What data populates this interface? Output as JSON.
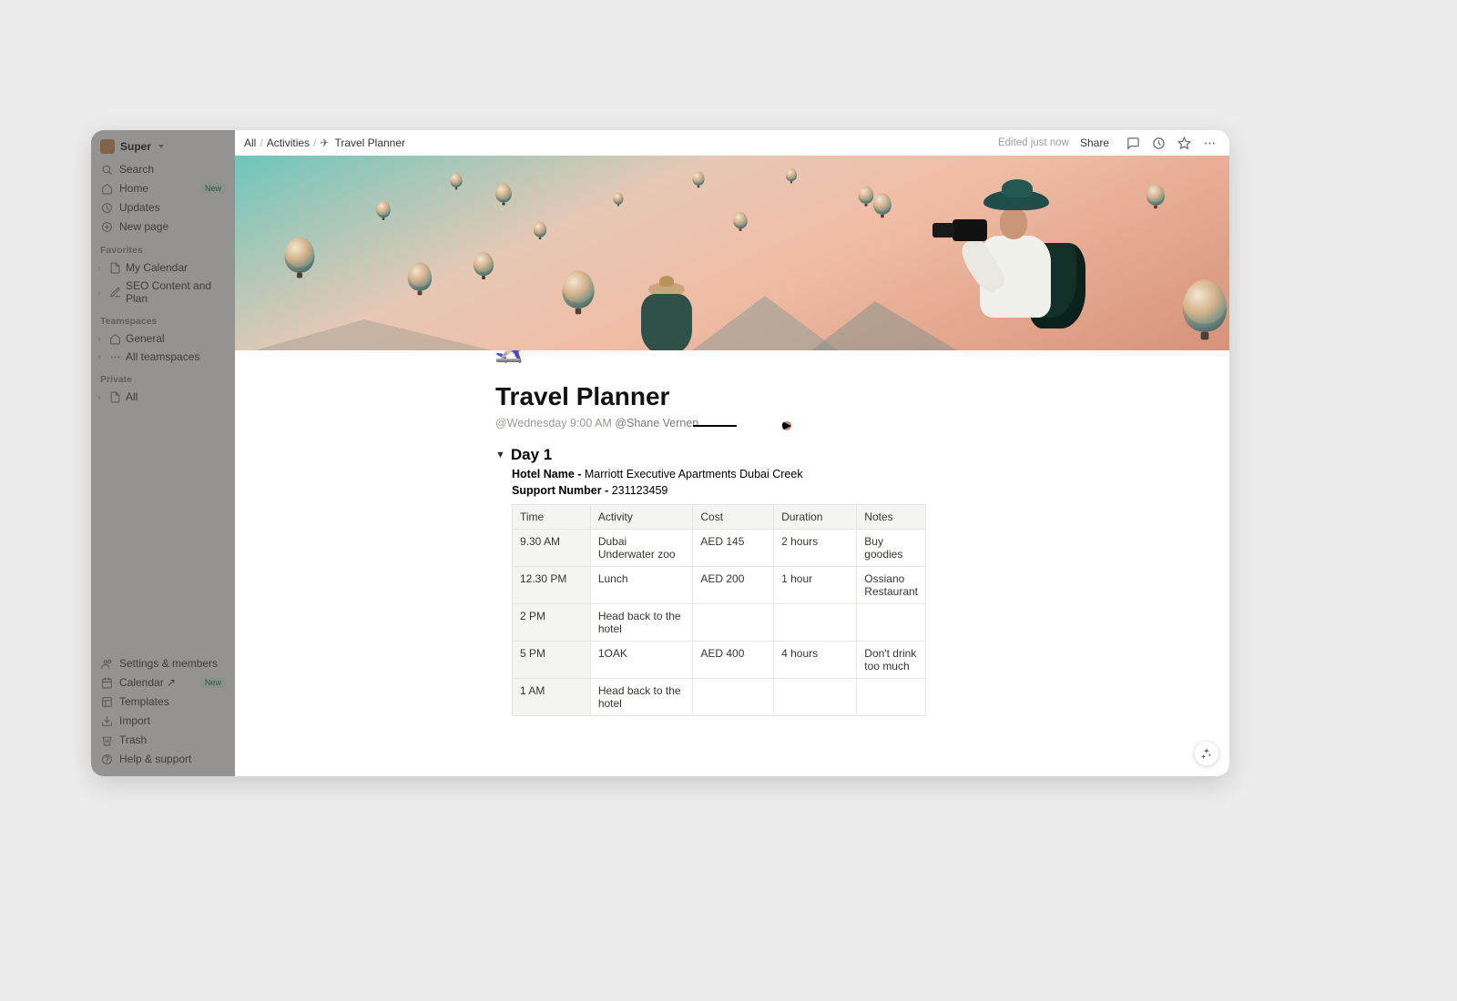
{
  "sidebar": {
    "workspace": "Super",
    "nav": [
      {
        "icon": "search",
        "label": "Search"
      },
      {
        "icon": "home",
        "label": "Home",
        "pill": "New"
      },
      {
        "icon": "clock",
        "label": "Updates"
      },
      {
        "icon": "plus",
        "label": "New page"
      }
    ],
    "sections": {
      "favorites_label": "Favorites",
      "favorites": [
        {
          "icon": "doc",
          "label": "My Calendar"
        },
        {
          "icon": "edit",
          "label": "SEO Content and Plan"
        }
      ],
      "teamspaces_label": "Teamspaces",
      "teamspaces": [
        {
          "icon": "home",
          "label": "General",
          "selected": true
        },
        {
          "icon": "dots",
          "label": "All teamspaces"
        }
      ],
      "private_label": "Private",
      "private": [
        {
          "icon": "doc",
          "label": "All"
        }
      ]
    },
    "footer": [
      {
        "icon": "people",
        "label": "Settings & members"
      },
      {
        "icon": "cal",
        "label": "Calendar ↗",
        "pill": "New"
      },
      {
        "icon": "tmpl",
        "label": "Templates"
      },
      {
        "icon": "import",
        "label": "Import"
      },
      {
        "icon": "trash",
        "label": "Trash"
      },
      {
        "icon": "help",
        "label": "Help & support"
      }
    ]
  },
  "topbar": {
    "breadcrumb": [
      "All",
      "Activities",
      "Travel Planner"
    ],
    "breadcrumb_icon": "✈︎",
    "edited": "Edited just now",
    "share": "Share"
  },
  "page": {
    "title": "Travel Planner",
    "reminder_prefix": "@",
    "reminder": "Wednesday 9:00 AM",
    "mention": "@Shane Vernen",
    "section": "Day 1",
    "hotel_label": "Hotel Name - ",
    "hotel_value": "Marriott Executive Apartments Dubai Creek",
    "support_label": "Support Number - ",
    "support_value": "231123459",
    "table": {
      "headers": [
        "Time",
        "Activity",
        "Cost",
        "Duration",
        "Notes"
      ],
      "rows": [
        {
          "time": "9.30 AM",
          "activity": "Dubai Underwater zoo",
          "cost": "AED 145",
          "duration": "2 hours",
          "notes": "Buy goodies"
        },
        {
          "time": "12.30 PM",
          "activity": "Lunch",
          "cost": "AED 200",
          "duration": "1 hour",
          "notes": "Ossiano Restaurant"
        },
        {
          "time": "2 PM",
          "activity": "Head back to the hotel",
          "cost": "",
          "duration": "",
          "notes": ""
        },
        {
          "time": "5 PM",
          "activity": "1OAK",
          "cost": "AED 400",
          "duration": "4 hours",
          "notes": "Don't drink too much"
        },
        {
          "time": "1 AM",
          "activity": "Head back to the hotel",
          "cost": "",
          "duration": "",
          "notes": ""
        }
      ]
    }
  }
}
